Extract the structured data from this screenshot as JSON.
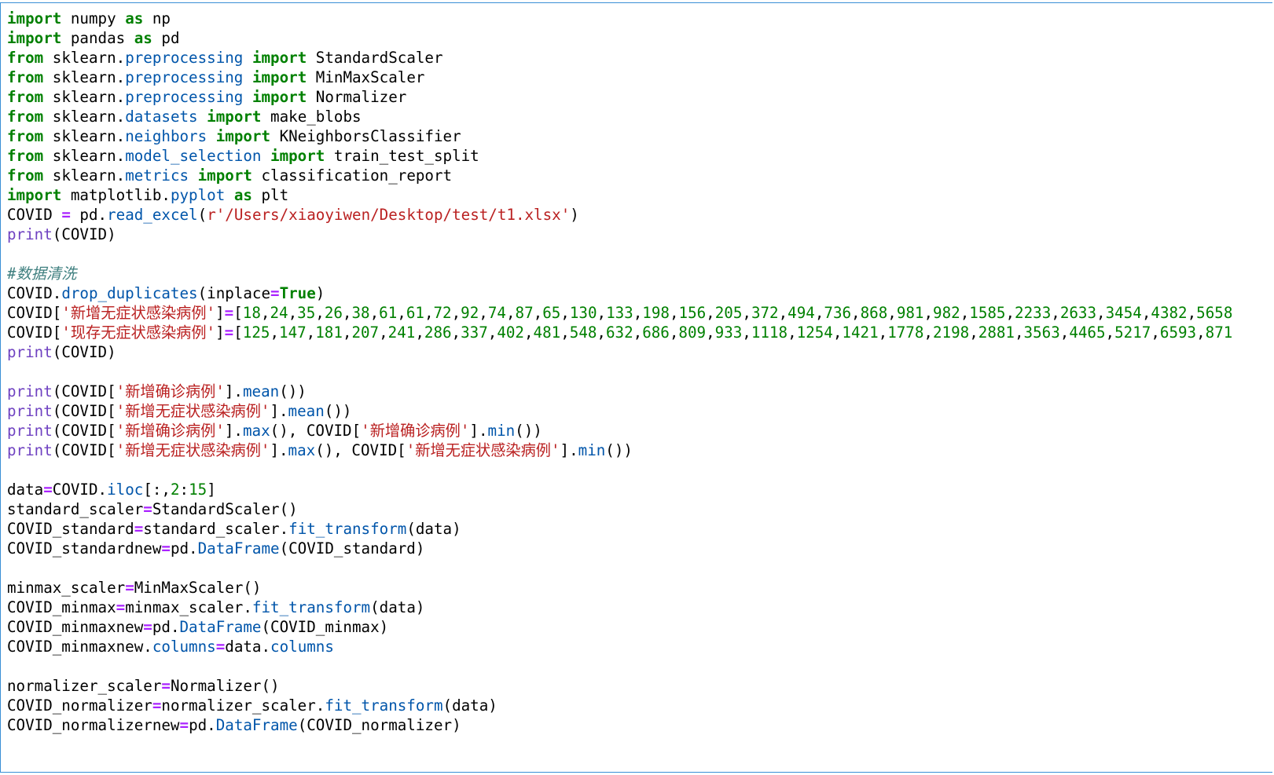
{
  "code": {
    "lines": [
      [
        {
          "t": "import",
          "c": "kw"
        },
        {
          "t": " numpy "
        },
        {
          "t": "as",
          "c": "kw"
        },
        {
          "t": " np"
        }
      ],
      [
        {
          "t": "import",
          "c": "kw"
        },
        {
          "t": " pandas "
        },
        {
          "t": "as",
          "c": "kw"
        },
        {
          "t": " pd"
        }
      ],
      [
        {
          "t": "from",
          "c": "kw"
        },
        {
          "t": " sklearn."
        },
        {
          "t": "preprocessing",
          "c": "mod"
        },
        {
          "t": " "
        },
        {
          "t": "import",
          "c": "kw"
        },
        {
          "t": " StandardScaler"
        }
      ],
      [
        {
          "t": "from",
          "c": "kw"
        },
        {
          "t": " sklearn."
        },
        {
          "t": "preprocessing",
          "c": "mod"
        },
        {
          "t": " "
        },
        {
          "t": "import",
          "c": "kw"
        },
        {
          "t": " MinMaxScaler"
        }
      ],
      [
        {
          "t": "from",
          "c": "kw"
        },
        {
          "t": " sklearn."
        },
        {
          "t": "preprocessing",
          "c": "mod"
        },
        {
          "t": " "
        },
        {
          "t": "import",
          "c": "kw"
        },
        {
          "t": " Normalizer"
        }
      ],
      [
        {
          "t": "from",
          "c": "kw"
        },
        {
          "t": " sklearn."
        },
        {
          "t": "datasets",
          "c": "mod"
        },
        {
          "t": " "
        },
        {
          "t": "import",
          "c": "kw"
        },
        {
          "t": " make_blobs"
        }
      ],
      [
        {
          "t": "from",
          "c": "kw"
        },
        {
          "t": " sklearn."
        },
        {
          "t": "neighbors",
          "c": "mod"
        },
        {
          "t": " "
        },
        {
          "t": "import",
          "c": "kw"
        },
        {
          "t": " KNeighborsClassifier"
        }
      ],
      [
        {
          "t": "from",
          "c": "kw"
        },
        {
          "t": " sklearn."
        },
        {
          "t": "model_selection",
          "c": "mod"
        },
        {
          "t": " "
        },
        {
          "t": "import",
          "c": "kw"
        },
        {
          "t": " train_test_split"
        }
      ],
      [
        {
          "t": "from",
          "c": "kw"
        },
        {
          "t": " sklearn."
        },
        {
          "t": "metrics",
          "c": "mod"
        },
        {
          "t": " "
        },
        {
          "t": "import",
          "c": "kw"
        },
        {
          "t": " classification_report"
        }
      ],
      [
        {
          "t": "import",
          "c": "kw"
        },
        {
          "t": " matplotlib."
        },
        {
          "t": "pyplot",
          "c": "mod"
        },
        {
          "t": " "
        },
        {
          "t": "as",
          "c": "kw"
        },
        {
          "t": " plt"
        }
      ],
      [
        {
          "t": "COVID "
        },
        {
          "t": "=",
          "c": "op"
        },
        {
          "t": " pd."
        },
        {
          "t": "read_excel",
          "c": "meth"
        },
        {
          "t": "("
        },
        {
          "t": "r'/Users/xiaoyiwen/Desktop/test/t1.xlsx'",
          "c": "str"
        },
        {
          "t": ")"
        }
      ],
      [
        {
          "t": "print",
          "c": "fn"
        },
        {
          "t": "(COVID)"
        }
      ],
      [],
      [
        {
          "t": "#数据清洗",
          "c": "cmt"
        }
      ],
      [
        {
          "t": "COVID."
        },
        {
          "t": "drop_duplicates",
          "c": "meth"
        },
        {
          "t": "(inplace"
        },
        {
          "t": "=",
          "c": "op"
        },
        {
          "t": "True",
          "c": "kw"
        },
        {
          "t": ")"
        }
      ],
      [
        {
          "t": "COVID["
        },
        {
          "t": "'新增无症状感染病例'",
          "c": "str"
        },
        {
          "t": "]"
        },
        {
          "t": "=",
          "c": "op"
        },
        {
          "t": "["
        },
        {
          "t": "18",
          "c": "num"
        },
        {
          "t": ","
        },
        {
          "t": "24",
          "c": "num"
        },
        {
          "t": ","
        },
        {
          "t": "35",
          "c": "num"
        },
        {
          "t": ","
        },
        {
          "t": "26",
          "c": "num"
        },
        {
          "t": ","
        },
        {
          "t": "38",
          "c": "num"
        },
        {
          "t": ","
        },
        {
          "t": "61",
          "c": "num"
        },
        {
          "t": ","
        },
        {
          "t": "61",
          "c": "num"
        },
        {
          "t": ","
        },
        {
          "t": "72",
          "c": "num"
        },
        {
          "t": ","
        },
        {
          "t": "92",
          "c": "num"
        },
        {
          "t": ","
        },
        {
          "t": "74",
          "c": "num"
        },
        {
          "t": ","
        },
        {
          "t": "87",
          "c": "num"
        },
        {
          "t": ","
        },
        {
          "t": "65",
          "c": "num"
        },
        {
          "t": ","
        },
        {
          "t": "130",
          "c": "num"
        },
        {
          "t": ","
        },
        {
          "t": "133",
          "c": "num"
        },
        {
          "t": ","
        },
        {
          "t": "198",
          "c": "num"
        },
        {
          "t": ","
        },
        {
          "t": "156",
          "c": "num"
        },
        {
          "t": ","
        },
        {
          "t": "205",
          "c": "num"
        },
        {
          "t": ","
        },
        {
          "t": "372",
          "c": "num"
        },
        {
          "t": ","
        },
        {
          "t": "494",
          "c": "num"
        },
        {
          "t": ","
        },
        {
          "t": "736",
          "c": "num"
        },
        {
          "t": ","
        },
        {
          "t": "868",
          "c": "num"
        },
        {
          "t": ","
        },
        {
          "t": "981",
          "c": "num"
        },
        {
          "t": ","
        },
        {
          "t": "982",
          "c": "num"
        },
        {
          "t": ","
        },
        {
          "t": "1585",
          "c": "num"
        },
        {
          "t": ","
        },
        {
          "t": "2233",
          "c": "num"
        },
        {
          "t": ","
        },
        {
          "t": "2633",
          "c": "num"
        },
        {
          "t": ","
        },
        {
          "t": "3454",
          "c": "num"
        },
        {
          "t": ","
        },
        {
          "t": "4382",
          "c": "num"
        },
        {
          "t": ","
        },
        {
          "t": "5658",
          "c": "num"
        }
      ],
      [
        {
          "t": "COVID["
        },
        {
          "t": "'现存无症状感染病例'",
          "c": "str"
        },
        {
          "t": "]"
        },
        {
          "t": "=",
          "c": "op"
        },
        {
          "t": "["
        },
        {
          "t": "125",
          "c": "num"
        },
        {
          "t": ","
        },
        {
          "t": "147",
          "c": "num"
        },
        {
          "t": ","
        },
        {
          "t": "181",
          "c": "num"
        },
        {
          "t": ","
        },
        {
          "t": "207",
          "c": "num"
        },
        {
          "t": ","
        },
        {
          "t": "241",
          "c": "num"
        },
        {
          "t": ","
        },
        {
          "t": "286",
          "c": "num"
        },
        {
          "t": ","
        },
        {
          "t": "337",
          "c": "num"
        },
        {
          "t": ","
        },
        {
          "t": "402",
          "c": "num"
        },
        {
          "t": ","
        },
        {
          "t": "481",
          "c": "num"
        },
        {
          "t": ","
        },
        {
          "t": "548",
          "c": "num"
        },
        {
          "t": ","
        },
        {
          "t": "632",
          "c": "num"
        },
        {
          "t": ","
        },
        {
          "t": "686",
          "c": "num"
        },
        {
          "t": ","
        },
        {
          "t": "809",
          "c": "num"
        },
        {
          "t": ","
        },
        {
          "t": "933",
          "c": "num"
        },
        {
          "t": ","
        },
        {
          "t": "1118",
          "c": "num"
        },
        {
          "t": ","
        },
        {
          "t": "1254",
          "c": "num"
        },
        {
          "t": ","
        },
        {
          "t": "1421",
          "c": "num"
        },
        {
          "t": ","
        },
        {
          "t": "1778",
          "c": "num"
        },
        {
          "t": ","
        },
        {
          "t": "2198",
          "c": "num"
        },
        {
          "t": ","
        },
        {
          "t": "2881",
          "c": "num"
        },
        {
          "t": ","
        },
        {
          "t": "3563",
          "c": "num"
        },
        {
          "t": ","
        },
        {
          "t": "4465",
          "c": "num"
        },
        {
          "t": ","
        },
        {
          "t": "5217",
          "c": "num"
        },
        {
          "t": ","
        },
        {
          "t": "6593",
          "c": "num"
        },
        {
          "t": ","
        },
        {
          "t": "871",
          "c": "num"
        }
      ],
      [
        {
          "t": "print",
          "c": "fn"
        },
        {
          "t": "(COVID)"
        }
      ],
      [],
      [
        {
          "t": "print",
          "c": "fn"
        },
        {
          "t": "(COVID["
        },
        {
          "t": "'新增确诊病例'",
          "c": "str"
        },
        {
          "t": "]."
        },
        {
          "t": "mean",
          "c": "meth"
        },
        {
          "t": "())"
        }
      ],
      [
        {
          "t": "print",
          "c": "fn"
        },
        {
          "t": "(COVID["
        },
        {
          "t": "'新增无症状感染病例'",
          "c": "str"
        },
        {
          "t": "]."
        },
        {
          "t": "mean",
          "c": "meth"
        },
        {
          "t": "())"
        }
      ],
      [
        {
          "t": "print",
          "c": "fn"
        },
        {
          "t": "(COVID["
        },
        {
          "t": "'新增确诊病例'",
          "c": "str"
        },
        {
          "t": "]."
        },
        {
          "t": "max",
          "c": "meth"
        },
        {
          "t": "(), COVID["
        },
        {
          "t": "'新增确诊病例'",
          "c": "str"
        },
        {
          "t": "]."
        },
        {
          "t": "min",
          "c": "meth"
        },
        {
          "t": "())"
        }
      ],
      [
        {
          "t": "print",
          "c": "fn"
        },
        {
          "t": "(COVID["
        },
        {
          "t": "'新增无症状感染病例'",
          "c": "str"
        },
        {
          "t": "]."
        },
        {
          "t": "max",
          "c": "meth"
        },
        {
          "t": "(), COVID["
        },
        {
          "t": "'新增无症状感染病例'",
          "c": "str"
        },
        {
          "t": "]."
        },
        {
          "t": "min",
          "c": "meth"
        },
        {
          "t": "())"
        }
      ],
      [],
      [
        {
          "t": "data"
        },
        {
          "t": "=",
          "c": "op"
        },
        {
          "t": "COVID."
        },
        {
          "t": "iloc",
          "c": "meth"
        },
        {
          "t": "[:,"
        },
        {
          "t": "2",
          "c": "num"
        },
        {
          "t": ":"
        },
        {
          "t": "15",
          "c": "num"
        },
        {
          "t": "]"
        }
      ],
      [
        {
          "t": "standard_scaler"
        },
        {
          "t": "=",
          "c": "op"
        },
        {
          "t": "StandardScaler()"
        }
      ],
      [
        {
          "t": "COVID_standard"
        },
        {
          "t": "=",
          "c": "op"
        },
        {
          "t": "standard_scaler."
        },
        {
          "t": "fit_transform",
          "c": "meth"
        },
        {
          "t": "(data)"
        }
      ],
      [
        {
          "t": "COVID_standardnew"
        },
        {
          "t": "=",
          "c": "op"
        },
        {
          "t": "pd."
        },
        {
          "t": "DataFrame",
          "c": "meth"
        },
        {
          "t": "(COVID_standard)"
        }
      ],
      [],
      [
        {
          "t": "minmax_scaler"
        },
        {
          "t": "=",
          "c": "op"
        },
        {
          "t": "MinMaxScaler()"
        }
      ],
      [
        {
          "t": "COVID_minmax"
        },
        {
          "t": "=",
          "c": "op"
        },
        {
          "t": "minmax_scaler."
        },
        {
          "t": "fit_transform",
          "c": "meth"
        },
        {
          "t": "(data)"
        }
      ],
      [
        {
          "t": "COVID_minmaxnew"
        },
        {
          "t": "=",
          "c": "op"
        },
        {
          "t": "pd."
        },
        {
          "t": "DataFrame",
          "c": "meth"
        },
        {
          "t": "(COVID_minmax)"
        }
      ],
      [
        {
          "t": "COVID_minmaxnew."
        },
        {
          "t": "columns",
          "c": "meth"
        },
        {
          "t": "=",
          "c": "op"
        },
        {
          "t": "data."
        },
        {
          "t": "columns",
          "c": "meth"
        }
      ],
      [],
      [
        {
          "t": "normalizer_scaler"
        },
        {
          "t": "=",
          "c": "op"
        },
        {
          "t": "Normalizer()"
        }
      ],
      [
        {
          "t": "COVID_normalizer"
        },
        {
          "t": "=",
          "c": "op"
        },
        {
          "t": "normalizer_scaler."
        },
        {
          "t": "fit_transform",
          "c": "meth"
        },
        {
          "t": "(data)"
        }
      ],
      [
        {
          "t": "COVID_normalizernew"
        },
        {
          "t": "=",
          "c": "op"
        },
        {
          "t": "pd."
        },
        {
          "t": "DataFrame",
          "c": "meth"
        },
        {
          "t": "(COVID_normalizer)"
        }
      ]
    ]
  }
}
